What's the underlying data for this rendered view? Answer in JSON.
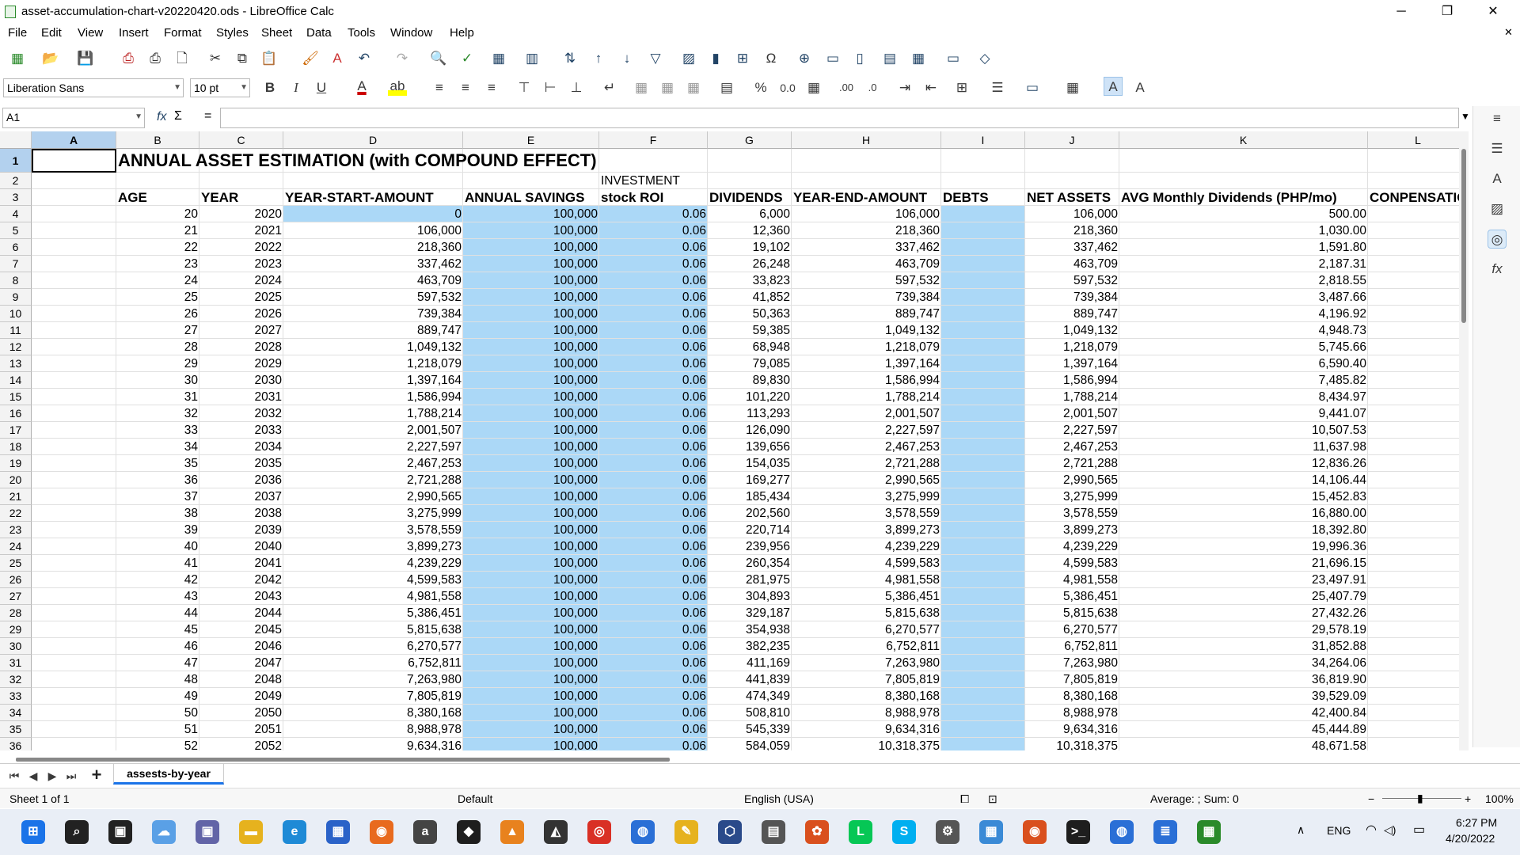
{
  "window": {
    "title": "asset-accumulation-chart-v20220420.ods - LibreOffice Calc",
    "minimize": "─",
    "restore": "❐",
    "close": "✕",
    "close_doc": "✕"
  },
  "menu": [
    "File",
    "Edit",
    "View",
    "Insert",
    "Format",
    "Styles",
    "Sheet",
    "Data",
    "Tools",
    "Window",
    "Help"
  ],
  "toolbar1": [
    {
      "name": "new-icon",
      "glyph": "▦",
      "color": "#2a8a2a"
    },
    {
      "name": "open-icon",
      "glyph": "📂",
      "color": "#d99a1e"
    },
    {
      "name": "save-icon",
      "glyph": "💾",
      "color": "#6a3a9a"
    },
    {
      "name": "export-pdf-icon",
      "glyph": "⎙",
      "color": "#b22"
    },
    {
      "name": "print-icon",
      "glyph": "⎙",
      "color": "#333"
    },
    {
      "name": "print-preview-icon",
      "glyph": "🗋",
      "color": "#333"
    },
    {
      "name": "cut-icon",
      "glyph": "✂",
      "color": "#333"
    },
    {
      "name": "copy-icon",
      "glyph": "⧉",
      "color": "#333"
    },
    {
      "name": "paste-icon",
      "glyph": "📋",
      "color": "#333"
    },
    {
      "name": "clone-formatting-icon",
      "glyph": "🖌",
      "color": "#c60"
    },
    {
      "name": "clear-formatting-icon",
      "glyph": "A",
      "color": "#c33"
    },
    {
      "name": "undo-icon",
      "glyph": "↶",
      "color": "#246"
    },
    {
      "name": "redo-icon",
      "glyph": "↷",
      "color": "#aaa"
    },
    {
      "name": "find-replace-icon",
      "glyph": "🔍",
      "color": "#333"
    },
    {
      "name": "spelling-icon",
      "glyph": "✓",
      "color": "#2a8a2a"
    },
    {
      "name": "row-icon",
      "glyph": "▦",
      "color": "#246"
    },
    {
      "name": "column-icon",
      "glyph": "▥",
      "color": "#246"
    },
    {
      "name": "sort-icon",
      "glyph": "⇅",
      "color": "#246"
    },
    {
      "name": "sort-ascending-icon",
      "glyph": "↑",
      "color": "#246"
    },
    {
      "name": "sort-descending-icon",
      "glyph": "↓",
      "color": "#246"
    },
    {
      "name": "autofilter-icon",
      "glyph": "▽",
      "color": "#246"
    },
    {
      "name": "image-icon",
      "glyph": "▨",
      "color": "#246"
    },
    {
      "name": "chart-icon",
      "glyph": "▮",
      "color": "#246"
    },
    {
      "name": "pivot-table-icon",
      "glyph": "⊞",
      "color": "#246"
    },
    {
      "name": "special-character-icon",
      "glyph": "Ω",
      "color": "#333"
    },
    {
      "name": "hyperlink-icon",
      "glyph": "⊕",
      "color": "#246"
    },
    {
      "name": "comment-icon",
      "glyph": "▭",
      "color": "#246"
    },
    {
      "name": "header-footer-icon",
      "glyph": "▯",
      "color": "#246"
    },
    {
      "name": "define-print-area-icon",
      "glyph": "▤",
      "color": "#246"
    },
    {
      "name": "freeze-rows-columns-icon",
      "glyph": "▦",
      "color": "#246"
    },
    {
      "name": "split-window-icon",
      "glyph": "▭",
      "color": "#246"
    },
    {
      "name": "show-draw-functions-icon",
      "glyph": "◇",
      "color": "#246"
    }
  ],
  "toolbar2": {
    "font_name": "Liberation Sans",
    "font_size": "10 pt",
    "bold": "B",
    "italic": "I",
    "underline": "U",
    "font_color": "A",
    "highlight": "ab",
    "percent": "%",
    "decimal": "0.0",
    "add_decimal": ".00",
    "delete_decimal": ".0"
  },
  "formula": {
    "cell_ref": "A1",
    "fx": "fx",
    "sum": "Σ",
    "equals": "=",
    "value": ""
  },
  "columns": [
    {
      "label": "A",
      "selected": true
    },
    {
      "label": "B"
    },
    {
      "label": "C"
    },
    {
      "label": "D"
    },
    {
      "label": "E"
    },
    {
      "label": "F"
    },
    {
      "label": "G"
    },
    {
      "label": "H"
    },
    {
      "label": "I"
    },
    {
      "label": "J"
    },
    {
      "label": "K"
    },
    {
      "label": "L"
    }
  ],
  "sheet": {
    "title": "ANNUAL  ASSET ESTIMATION (with COMPOUND EFFECT)",
    "investment_label": "INVESTMENT",
    "headers": [
      "AGE",
      "YEAR",
      "YEAR-START-AMOUNT",
      "ANNUAL SAVINGS",
      "stock ROI",
      "DIVIDENDS",
      "YEAR-END-AMOUNT",
      "DEBTS",
      "NET ASSETS",
      "AVG Monthly Dividends (PHP/mo)",
      "CONPENSATIO"
    ],
    "rows": [
      [
        "20",
        "2020",
        "0",
        "100,000",
        "0.06",
        "6,000",
        "106,000",
        "",
        "106,000",
        "500.00"
      ],
      [
        "21",
        "2021",
        "106,000",
        "100,000",
        "0.06",
        "12,360",
        "218,360",
        "",
        "218,360",
        "1,030.00"
      ],
      [
        "22",
        "2022",
        "218,360",
        "100,000",
        "0.06",
        "19,102",
        "337,462",
        "",
        "337,462",
        "1,591.80"
      ],
      [
        "23",
        "2023",
        "337,462",
        "100,000",
        "0.06",
        "26,248",
        "463,709",
        "",
        "463,709",
        "2,187.31"
      ],
      [
        "24",
        "2024",
        "463,709",
        "100,000",
        "0.06",
        "33,823",
        "597,532",
        "",
        "597,532",
        "2,818.55"
      ],
      [
        "25",
        "2025",
        "597,532",
        "100,000",
        "0.06",
        "41,852",
        "739,384",
        "",
        "739,384",
        "3,487.66"
      ],
      [
        "26",
        "2026",
        "739,384",
        "100,000",
        "0.06",
        "50,363",
        "889,747",
        "",
        "889,747",
        "4,196.92"
      ],
      [
        "27",
        "2027",
        "889,747",
        "100,000",
        "0.06",
        "59,385",
        "1,049,132",
        "",
        "1,049,132",
        "4,948.73"
      ],
      [
        "28",
        "2028",
        "1,049,132",
        "100,000",
        "0.06",
        "68,948",
        "1,218,079",
        "",
        "1,218,079",
        "5,745.66"
      ],
      [
        "29",
        "2029",
        "1,218,079",
        "100,000",
        "0.06",
        "79,085",
        "1,397,164",
        "",
        "1,397,164",
        "6,590.40"
      ],
      [
        "30",
        "2030",
        "1,397,164",
        "100,000",
        "0.06",
        "89,830",
        "1,586,994",
        "",
        "1,586,994",
        "7,485.82"
      ],
      [
        "31",
        "2031",
        "1,586,994",
        "100,000",
        "0.06",
        "101,220",
        "1,788,214",
        "",
        "1,788,214",
        "8,434.97"
      ],
      [
        "32",
        "2032",
        "1,788,214",
        "100,000",
        "0.06",
        "113,293",
        "2,001,507",
        "",
        "2,001,507",
        "9,441.07"
      ],
      [
        "33",
        "2033",
        "2,001,507",
        "100,000",
        "0.06",
        "126,090",
        "2,227,597",
        "",
        "2,227,597",
        "10,507.53"
      ],
      [
        "34",
        "2034",
        "2,227,597",
        "100,000",
        "0.06",
        "139,656",
        "2,467,253",
        "",
        "2,467,253",
        "11,637.98"
      ],
      [
        "35",
        "2035",
        "2,467,253",
        "100,000",
        "0.06",
        "154,035",
        "2,721,288",
        "",
        "2,721,288",
        "12,836.26"
      ],
      [
        "36",
        "2036",
        "2,721,288",
        "100,000",
        "0.06",
        "169,277",
        "2,990,565",
        "",
        "2,990,565",
        "14,106.44"
      ],
      [
        "37",
        "2037",
        "2,990,565",
        "100,000",
        "0.06",
        "185,434",
        "3,275,999",
        "",
        "3,275,999",
        "15,452.83"
      ],
      [
        "38",
        "2038",
        "3,275,999",
        "100,000",
        "0.06",
        "202,560",
        "3,578,559",
        "",
        "3,578,559",
        "16,880.00"
      ],
      [
        "39",
        "2039",
        "3,578,559",
        "100,000",
        "0.06",
        "220,714",
        "3,899,273",
        "",
        "3,899,273",
        "18,392.80"
      ],
      [
        "40",
        "2040",
        "3,899,273",
        "100,000",
        "0.06",
        "239,956",
        "4,239,229",
        "",
        "4,239,229",
        "19,996.36"
      ],
      [
        "41",
        "2041",
        "4,239,229",
        "100,000",
        "0.06",
        "260,354",
        "4,599,583",
        "",
        "4,599,583",
        "21,696.15"
      ],
      [
        "42",
        "2042",
        "4,599,583",
        "100,000",
        "0.06",
        "281,975",
        "4,981,558",
        "",
        "4,981,558",
        "23,497.91"
      ],
      [
        "43",
        "2043",
        "4,981,558",
        "100,000",
        "0.06",
        "304,893",
        "5,386,451",
        "",
        "5,386,451",
        "25,407.79"
      ],
      [
        "44",
        "2044",
        "5,386,451",
        "100,000",
        "0.06",
        "329,187",
        "5,815,638",
        "",
        "5,815,638",
        "27,432.26"
      ],
      [
        "45",
        "2045",
        "5,815,638",
        "100,000",
        "0.06",
        "354,938",
        "6,270,577",
        "",
        "6,270,577",
        "29,578.19"
      ],
      [
        "46",
        "2046",
        "6,270,577",
        "100,000",
        "0.06",
        "382,235",
        "6,752,811",
        "",
        "6,752,811",
        "31,852.88"
      ],
      [
        "47",
        "2047",
        "6,752,811",
        "100,000",
        "0.06",
        "411,169",
        "7,263,980",
        "",
        "7,263,980",
        "34,264.06"
      ],
      [
        "48",
        "2048",
        "7,263,980",
        "100,000",
        "0.06",
        "441,839",
        "7,805,819",
        "",
        "7,805,819",
        "36,819.90"
      ],
      [
        "49",
        "2049",
        "7,805,819",
        "100,000",
        "0.06",
        "474,349",
        "8,380,168",
        "",
        "8,380,168",
        "39,529.09"
      ],
      [
        "50",
        "2050",
        "8,380,168",
        "100,000",
        "0.06",
        "508,810",
        "8,988,978",
        "",
        "8,988,978",
        "42,400.84"
      ],
      [
        "51",
        "2051",
        "8,988,978",
        "100,000",
        "0.06",
        "545,339",
        "9,634,316",
        "",
        "9,634,316",
        "45,444.89"
      ],
      [
        "52",
        "2052",
        "9,634,316",
        "100,000",
        "0.06",
        "584,059",
        "10,318,375",
        "",
        "10,318,375",
        "48,671.58"
      ]
    ]
  },
  "tabs": {
    "sheet_name": "assests-by-year",
    "add": "+"
  },
  "status": {
    "sheet": "Sheet 1 of 1",
    "style": "Default",
    "language": "English (USA)",
    "summary": "Average: ; Sum: 0",
    "zoom": "100%",
    "zoom_minus": "−",
    "zoom_plus": "+"
  },
  "taskbar": {
    "apps": [
      {
        "name": "windows-start-icon",
        "label": "⊞",
        "color": "#1a73e8"
      },
      {
        "name": "search-icon",
        "label": "⌕",
        "color": "#222"
      },
      {
        "name": "task-view-icon",
        "label": "▣",
        "color": "#222"
      },
      {
        "name": "onedrive-icon",
        "label": "☁",
        "color": "#5aa0e6"
      },
      {
        "name": "teams-chat-icon",
        "label": "▣",
        "color": "#6264a7"
      },
      {
        "name": "file-explorer-icon",
        "label": "▬",
        "color": "#e6b21e"
      },
      {
        "name": "edge-icon",
        "label": "e",
        "color": "#1e8ad6"
      },
      {
        "name": "store-icon",
        "label": "▦",
        "color": "#2a62c8"
      },
      {
        "name": "firefox-icon",
        "label": "◉",
        "color": "#e86a1e"
      },
      {
        "name": "amazon-icon",
        "label": "a",
        "color": "#444"
      },
      {
        "name": "dropbox-icon",
        "label": "◆",
        "color": "#1e1e1e"
      },
      {
        "name": "vlc-icon",
        "label": "▲",
        "color": "#e8821e"
      },
      {
        "name": "inkscape-icon",
        "label": "◭",
        "color": "#333"
      },
      {
        "name": "chrome-icon",
        "label": "◎",
        "color": "#d93025"
      },
      {
        "name": "app-blue-icon",
        "label": "◍",
        "color": "#2a6fd6"
      },
      {
        "name": "app-pen-icon",
        "label": "✎",
        "color": "#e6b21e"
      },
      {
        "name": "app-cube-icon",
        "label": "⬡",
        "color": "#2a4a8a"
      },
      {
        "name": "calculator-icon",
        "label": "▤",
        "color": "#555"
      },
      {
        "name": "photos-icon",
        "label": "✿",
        "color": "#d9501e"
      },
      {
        "name": "line-icon",
        "label": "L",
        "color": "#06c755"
      },
      {
        "name": "skype-icon",
        "label": "S",
        "color": "#00aff0"
      },
      {
        "name": "settings-icon",
        "label": "⚙",
        "color": "#555"
      },
      {
        "name": "control-panel-icon",
        "label": "▦",
        "color": "#3a8ad6"
      },
      {
        "name": "app-orange-icon",
        "label": "◉",
        "color": "#d9501e"
      },
      {
        "name": "terminal-icon",
        "label": ">_",
        "color": "#1e1e1e"
      },
      {
        "name": "app-blue2-icon",
        "label": "◍",
        "color": "#2a6fd6"
      },
      {
        "name": "notepad-icon",
        "label": "≣",
        "color": "#2a6fd6"
      },
      {
        "name": "libreoffice-calc-icon",
        "label": "▦",
        "color": "#2a8a2a"
      }
    ],
    "tray": {
      "chevron": "∧",
      "lang": "ENG",
      "wifi": "◠",
      "volume": "◁)",
      "battery": "▭",
      "time": "6:27 PM",
      "date": "4/20/2022"
    }
  }
}
